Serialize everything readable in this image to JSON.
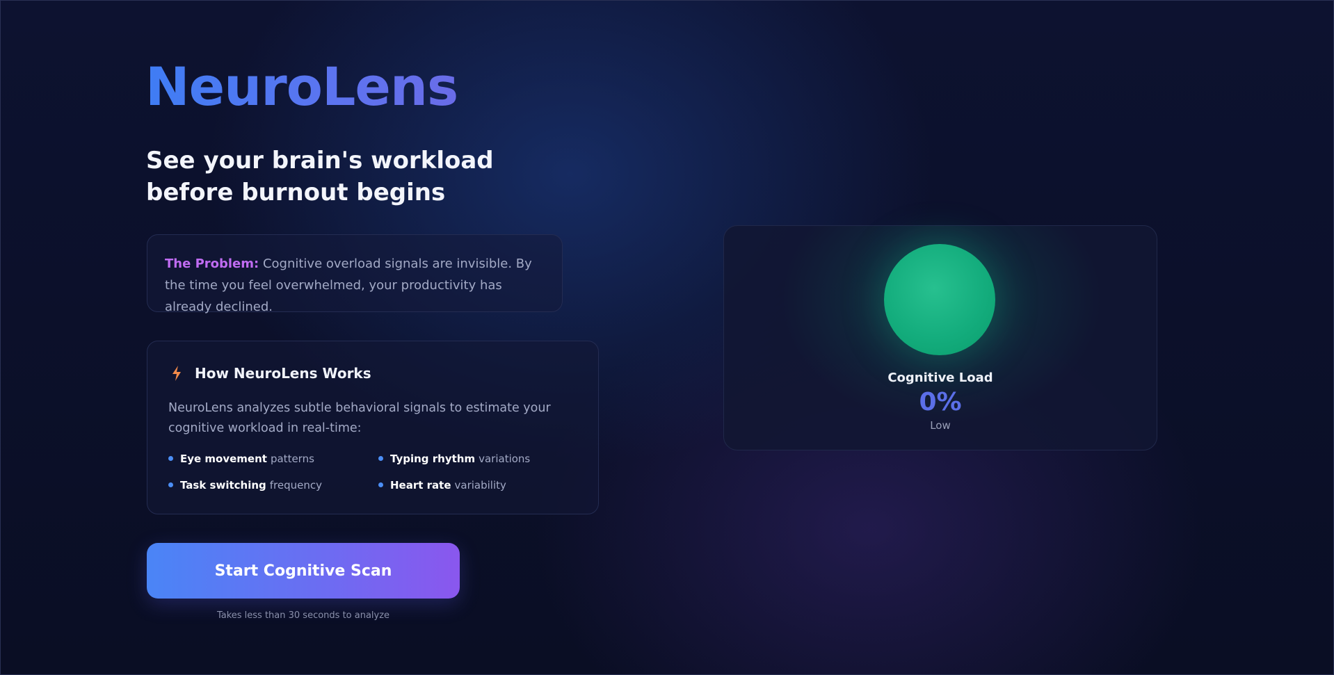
{
  "hero": {
    "brand": "NeuroLens",
    "headline": "See your brain's workload before burnout begins"
  },
  "problem": {
    "label": "The Problem:",
    "text": " Cognitive overload signals are invisible. By the time you feel overwhelmed, your productivity has already declined."
  },
  "how_it_works": {
    "icon": "lightning-bolt-icon",
    "title": "How NeuroLens Works",
    "description": "NeuroLens analyzes subtle behavioral signals to estimate your cognitive workload in real-time:",
    "signals": [
      {
        "strong": "Eye movement",
        "rest": "patterns"
      },
      {
        "strong": "Typing rhythm",
        "rest": "variations"
      },
      {
        "strong": "Task switching",
        "rest": "frequency"
      },
      {
        "strong": "Heart rate",
        "rest": "variability"
      }
    ]
  },
  "cta": {
    "button_label": "Start Cognitive Scan",
    "note": "Takes less than 30 seconds to analyze"
  },
  "load_panel": {
    "label": "Cognitive Load",
    "value": "0%",
    "level": "Low",
    "orb_color": "#14ad7d"
  },
  "colors": {
    "accent_blue": "#4a85f6",
    "accent_purple": "#8a57ee",
    "problem_label": "#c06cf2",
    "bolt": "#f28a4a",
    "bullet": "#4b8ef5",
    "background": "#0b0f26"
  }
}
